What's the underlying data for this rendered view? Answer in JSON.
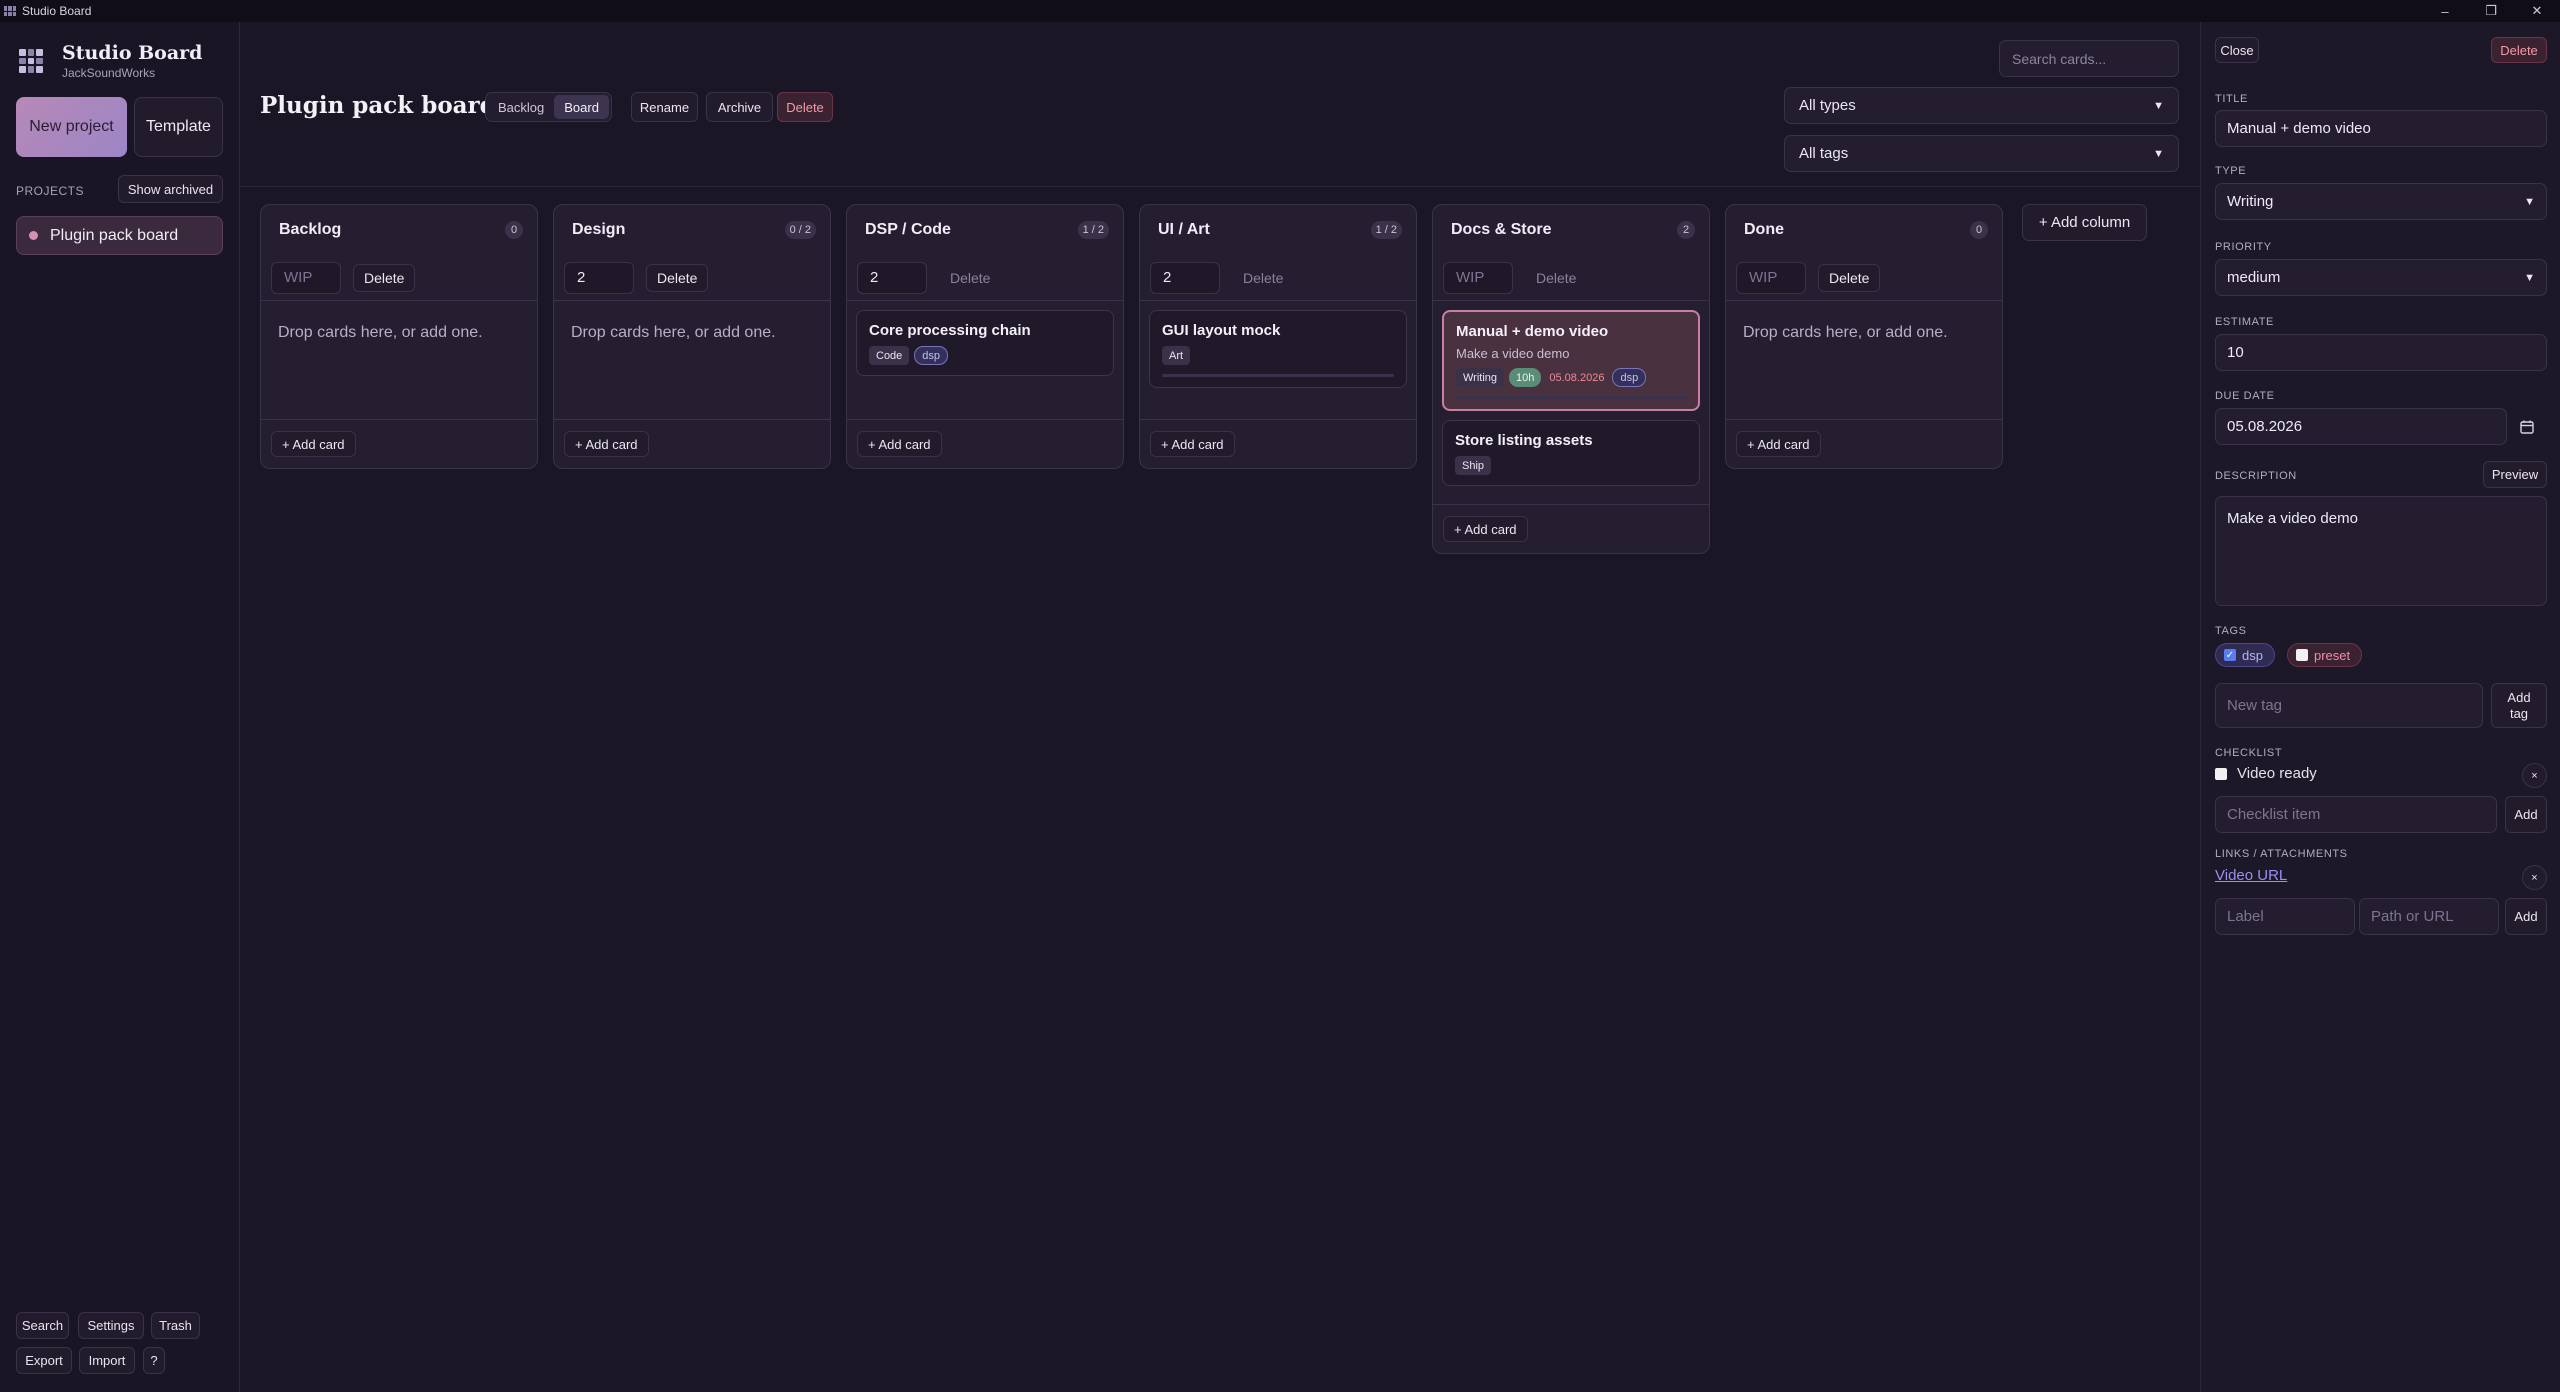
{
  "window": {
    "title": "Studio Board",
    "controls": {
      "minimize": "–",
      "maximize": "❐",
      "close": "✕"
    }
  },
  "sidebar": {
    "brand_name": "Studio Board",
    "brand_sub": "JackSoundWorks",
    "new_project": "New project",
    "template": "Template",
    "projects_label": "PROJECTS",
    "show_archived": "Show archived",
    "projects": [
      {
        "name": "Plugin pack board",
        "color": "#d690b4"
      }
    ],
    "footer": {
      "search": "Search",
      "settings": "Settings",
      "trash": "Trash",
      "export": "Export",
      "import": "Import",
      "help": "?"
    }
  },
  "header": {
    "title": "Plugin pack board",
    "views": [
      {
        "label": "Backlog",
        "active": false
      },
      {
        "label": "Board",
        "active": true
      }
    ],
    "rename": "Rename",
    "archive": "Archive",
    "delete": "Delete",
    "search_placeholder": "Search cards...",
    "type_filter": "All types",
    "tag_filter": "All tags"
  },
  "board": {
    "add_column": "+ Add column",
    "add_card": "+ Add card",
    "empty_message": "Drop cards here, or add one.",
    "wip_placeholder": "WIP",
    "delete_label": "Delete",
    "columns": [
      {
        "title": "Backlog",
        "count": "0",
        "wip": "",
        "cards": []
      },
      {
        "title": "Design",
        "count": "0 / 2",
        "wip": "2",
        "cards": []
      },
      {
        "title": "DSP / Code",
        "count": "1 / 2",
        "wip": "2",
        "cards": [
          {
            "title": "Core processing chain",
            "type": "Code",
            "tags": [
              "dsp"
            ]
          }
        ]
      },
      {
        "title": "UI / Art",
        "count": "1 / 2",
        "wip": "2",
        "cards": [
          {
            "title": "GUI layout mock",
            "type": "Art",
            "progress_bar": true
          }
        ]
      },
      {
        "title": "Docs & Store",
        "count": "2",
        "wip": "",
        "cards": [
          {
            "title": "Manual + demo video",
            "desc": "Make a video demo",
            "type": "Writing",
            "estimate": "10h",
            "due": "05.08.2026",
            "tags": [
              "dsp"
            ],
            "selected": true
          },
          {
            "title": "Store listing assets",
            "type": "Ship"
          }
        ]
      },
      {
        "title": "Done",
        "count": "0",
        "wip": "",
        "cards": []
      }
    ]
  },
  "panel": {
    "close": "Close",
    "delete": "Delete",
    "title_label": "TITLE",
    "title_value": "Manual + demo video",
    "type_label": "TYPE",
    "type_value": "Writing",
    "priority_label": "PRIORITY",
    "priority_value": "medium",
    "estimate_label": "ESTIMATE",
    "estimate_value": "10",
    "due_label": "DUE DATE",
    "due_value": "05.08.2026",
    "description_label": "DESCRIPTION",
    "preview": "Preview",
    "description_value": "Make a video demo",
    "tags_label": "TAGS",
    "tags": [
      {
        "name": "dsp",
        "checked": true
      },
      {
        "name": "preset",
        "checked": false
      }
    ],
    "new_tag_placeholder": "New tag",
    "add_tag": "Add tag",
    "checklist_label": "CHECKLIST",
    "checklist": [
      {
        "text": "Video ready",
        "done": false
      }
    ],
    "checklist_placeholder": "Checklist item",
    "add": "Add",
    "links_label": "LINKS / ATTACHMENTS",
    "links": [
      {
        "label": "Video URL"
      }
    ],
    "link_label_placeholder": "Label",
    "link_url_placeholder": "Path or URL",
    "remove": "×"
  }
}
